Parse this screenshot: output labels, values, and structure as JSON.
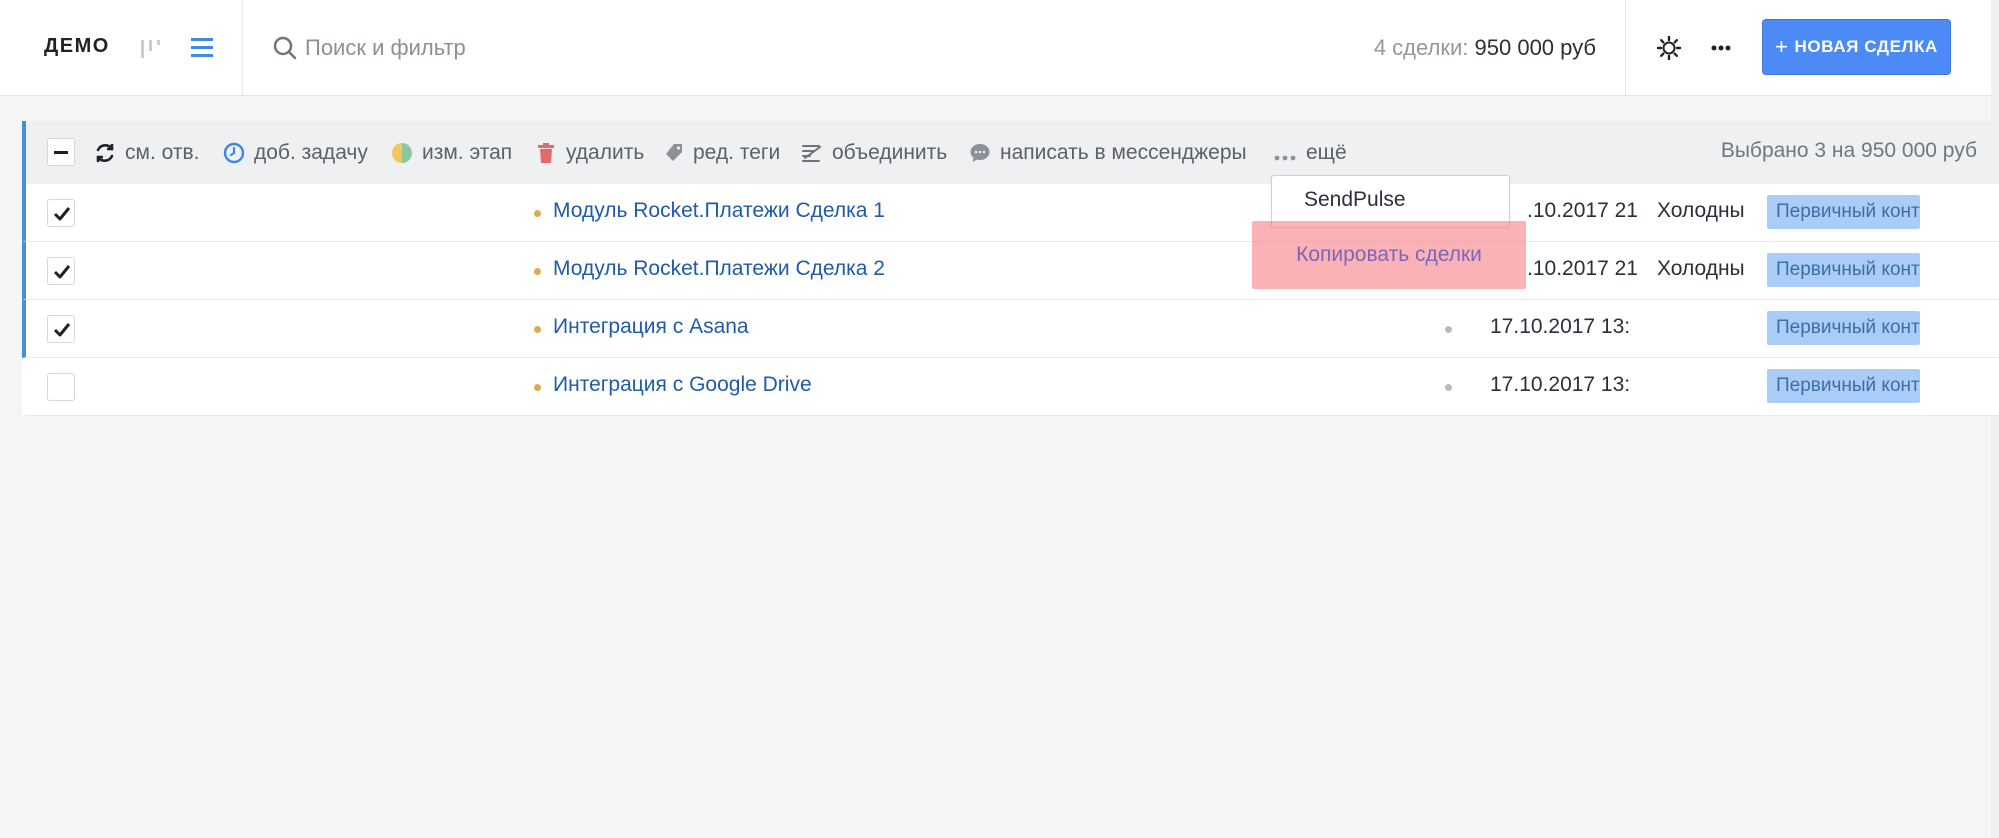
{
  "header": {
    "pipeline_name": "ДЕМО",
    "search": {
      "placeholder": "Поиск и фильтр",
      "value": ""
    },
    "deal_count_label": "4 сделки:",
    "deal_total": "950 000 руб",
    "new_deal_plus": "+",
    "new_deal_label": "НОВАЯ СДЕЛКА"
  },
  "action_bar": {
    "actions": [
      {
        "label": "см. отв.",
        "icon": "refresh-icon"
      },
      {
        "label": "доб. задачу",
        "icon": "clock-icon"
      },
      {
        "label": "изм. этап",
        "icon": "stage-circle-icon"
      },
      {
        "label": "удалить",
        "icon": "trash-icon"
      },
      {
        "label": "ред. теги",
        "icon": "tag-icon"
      },
      {
        "label": "объединить",
        "icon": "merge-icon"
      },
      {
        "label": "написать в мессенджеры",
        "icon": "chat-bubble-icon"
      },
      {
        "label": "ещё",
        "icon": "ellipsis-icon"
      }
    ],
    "selected_summary": "Выбрано 3 на 950 000 руб"
  },
  "rows": [
    {
      "name": "Модуль Rocket.Платежи Сделка 1",
      "checked": true,
      "date": ".10.2017 21",
      "status": "Холодны",
      "tag": "Первичный конта",
      "dot_color": "#e0a951"
    },
    {
      "name": "Модуль Rocket.Платежи Сделка 2",
      "checked": true,
      "date": ".10.2017 21",
      "status": "Холодны",
      "tag": "Первичный конта",
      "dot_color": "#e0a951"
    },
    {
      "name": "Интеграция с Asana",
      "checked": true,
      "date": "17.10.2017 13:",
      "status": "",
      "tag": "Первичный конта",
      "dot_color": "#e0a951"
    },
    {
      "name": "Интеграция с Google Drive",
      "checked": false,
      "date": "17.10.2017 13:",
      "status": "",
      "tag": "Первичный конта",
      "dot_color": "#e0a951"
    }
  ],
  "dropdown": {
    "items": [
      "SendPulse",
      "Копировать сделки"
    ]
  },
  "colors": {
    "accent": "#4c8bf5",
    "selection_bar": "#4390d8",
    "link": "#1f5ba8",
    "tag_bg": "#a9cdf7",
    "highlight": "#f9828a"
  }
}
